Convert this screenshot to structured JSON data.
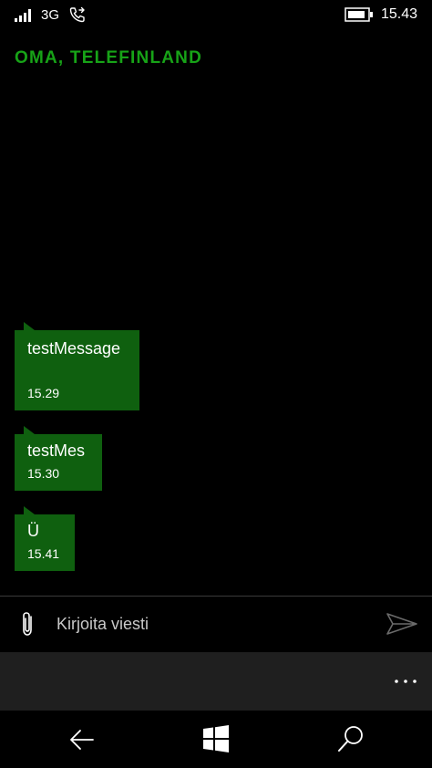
{
  "status_bar": {
    "network": "3G",
    "time": "15.43",
    "icons": [
      "signal-icon",
      "call-forward-icon",
      "battery-icon"
    ]
  },
  "header": {
    "title": "OMA, TELEFINLAND"
  },
  "messages": [
    {
      "text": "testMessage",
      "time": "15.29"
    },
    {
      "text": "testMes",
      "time": "15.30"
    },
    {
      "text": "Ü",
      "time": "15.41"
    }
  ],
  "compose": {
    "placeholder": "Kirjoita viesti",
    "attach_icon": "paperclip-icon",
    "send_icon": "send-icon"
  },
  "app_bar": {
    "more_icon": "more-icon"
  },
  "nav_bar": {
    "icons": [
      "back-arrow-icon",
      "windows-start-icon",
      "search-icon"
    ]
  },
  "colors": {
    "accent": "#17a317",
    "bubble": "#0f600f",
    "background": "#000000",
    "app_bar": "#1f1f1f"
  }
}
